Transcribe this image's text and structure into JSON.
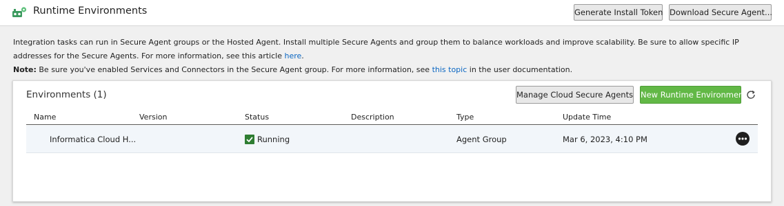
{
  "header": {
    "title": "Runtime Environments",
    "buttons": {
      "generate_token": "Generate Install Token",
      "download_agent": "Download Secure Agent..."
    }
  },
  "info": {
    "line1_text": "Integration tasks can run in Secure Agent groups or the Hosted Agent. Install multiple Secure Agents and group them to balance workloads and improve scalability. Be sure to allow specific IP addresses for the Secure Agents. For more information, see this article ",
    "line1_link": "here",
    "line1_end": ".",
    "note_label": "Note:",
    "note_text": " Be sure you've enabled Services and Connectors in the Secure Agent group. For more information, see ",
    "note_link": "this topic",
    "note_end": " in the user documentation."
  },
  "environments": {
    "title": "Environments (1)",
    "manage_button": "Manage Cloud Secure Agents",
    "new_button": "New Runtime Environment",
    "columns": [
      "Name",
      "Version",
      "Status",
      "Description",
      "Type",
      "Update Time"
    ],
    "rows": [
      {
        "name": "Informatica Cloud H...",
        "version": "",
        "status": "Running",
        "description": "",
        "type": "Agent Group",
        "update_time": "Mar 6, 2023, 4:10 PM"
      }
    ]
  },
  "colors": {
    "primary_button": "#62b846",
    "link": "#0a66c2",
    "status_running": "#2e7d32"
  },
  "icons": [
    "runtime-environments-icon",
    "refresh-icon",
    "check-icon",
    "more-options-icon"
  ]
}
